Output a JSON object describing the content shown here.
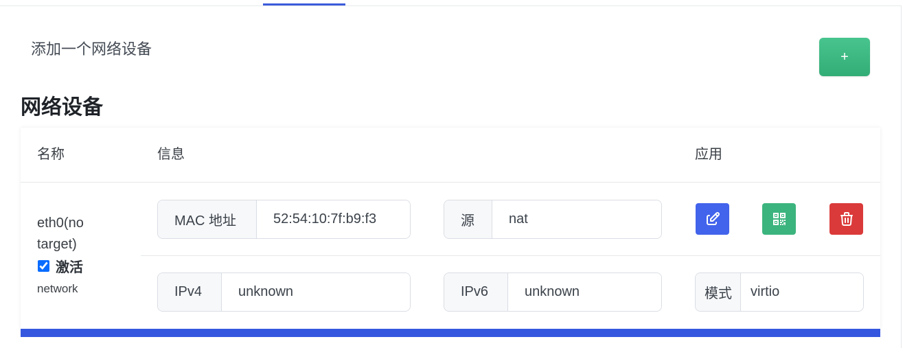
{
  "add_section": {
    "label": "添加一个网络设备",
    "add_button_label": "+"
  },
  "section_title": "网络设备",
  "table": {
    "columns": [
      "名称",
      "信息",
      "应用"
    ],
    "rows": [
      {
        "name": "eth0(no target)",
        "active_label": "激活",
        "active_checked": true,
        "type": "network",
        "fields": {
          "mac": {
            "label": "MAC 地址",
            "value": "52:54:10:7f:b9:f3"
          },
          "source": {
            "label": "源",
            "value": "nat"
          },
          "ipv4": {
            "label": "IPv4",
            "value": "unknown"
          },
          "ipv6": {
            "label": "IPv6",
            "value": "unknown"
          },
          "model": {
            "label": "模式",
            "value": "virtio"
          }
        },
        "actions": [
          {
            "icon": "edit-icon",
            "color": "#4263eb"
          },
          {
            "icon": "qrcode-icon",
            "color": "#3cb47e"
          },
          {
            "icon": "trash-icon",
            "color": "#db3a3a"
          }
        ]
      }
    ]
  },
  "colors": {
    "tab_indicator": "#3b5bdb",
    "card_bar": "#3557df",
    "add_button": "#3cb47e"
  }
}
